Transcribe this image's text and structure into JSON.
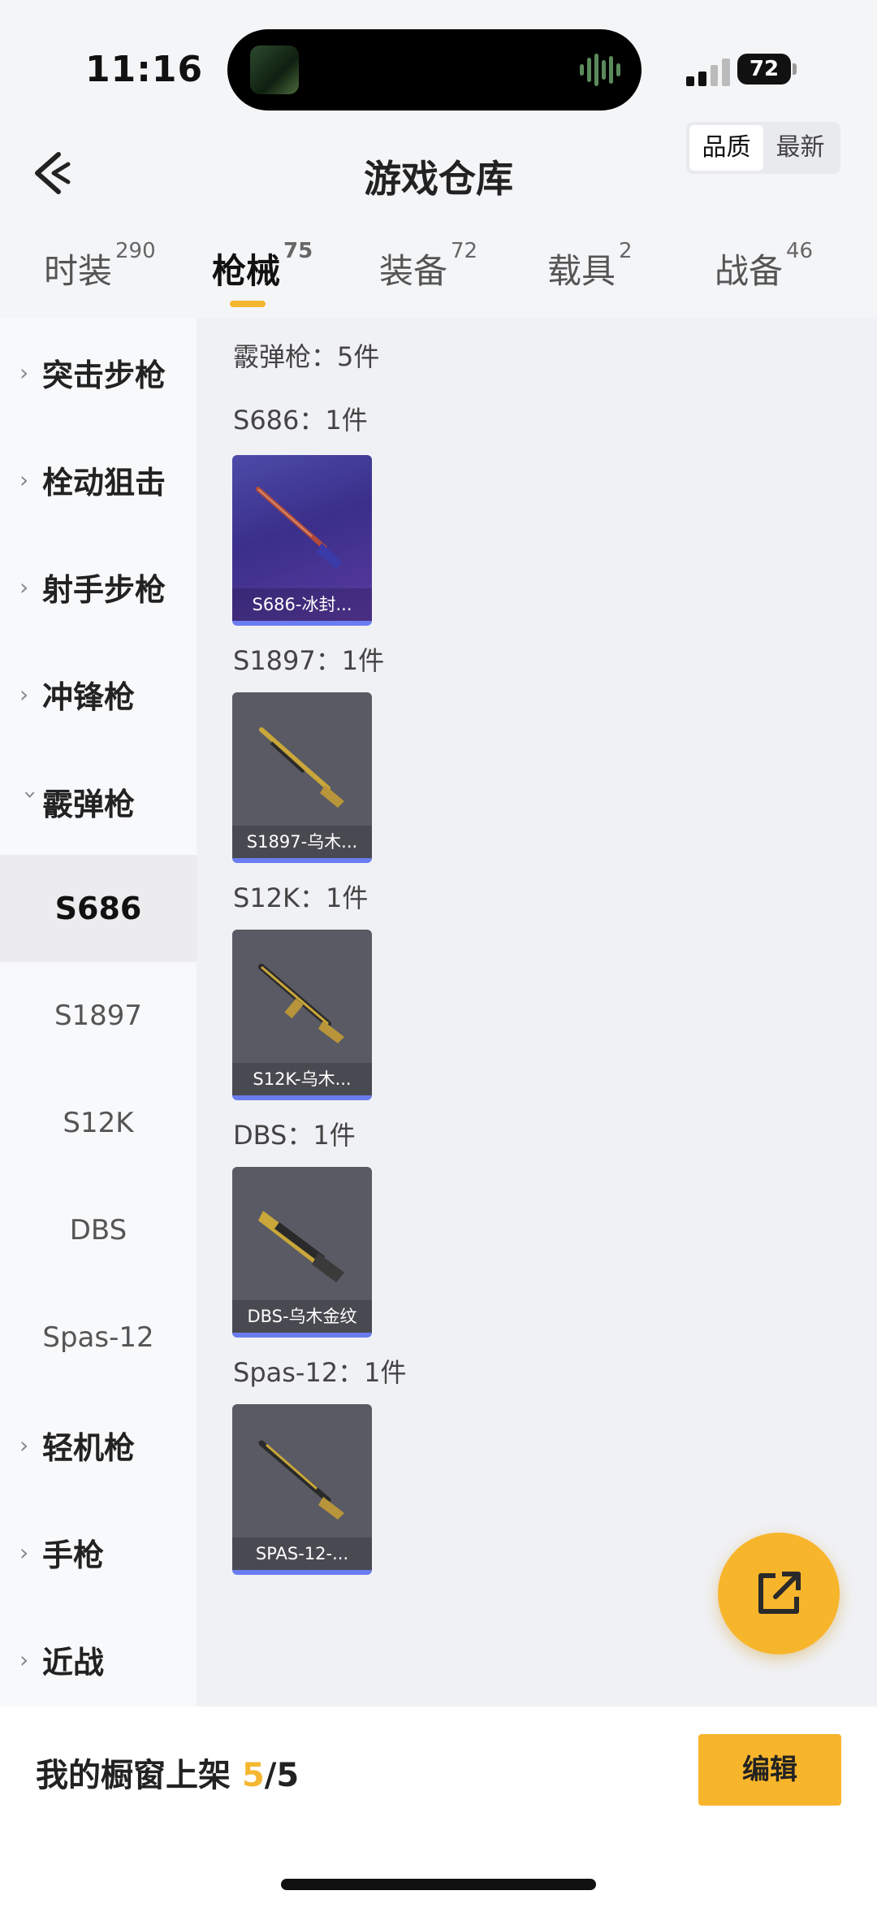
{
  "status_bar": {
    "time": "11:16",
    "battery": "72"
  },
  "header": {
    "title": "游戏仓库",
    "sort_options": [
      "品质",
      "最新"
    ],
    "sort_active": "品质"
  },
  "tabs": [
    {
      "label": "时装",
      "count": "290"
    },
    {
      "label": "枪械",
      "count": "75",
      "active": true
    },
    {
      "label": "装备",
      "count": "72"
    },
    {
      "label": "载具",
      "count": "2"
    },
    {
      "label": "战备",
      "count": "46"
    }
  ],
  "sidebar": {
    "categories": [
      {
        "label": "突击步枪"
      },
      {
        "label": "栓动狙击"
      },
      {
        "label": "射手步枪"
      },
      {
        "label": "冲锋枪"
      },
      {
        "label": "霰弹枪",
        "expanded": true
      }
    ],
    "subitems": [
      {
        "label": "S686",
        "active": true
      },
      {
        "label": "S1897"
      },
      {
        "label": "S12K"
      },
      {
        "label": "DBS"
      },
      {
        "label": "Spas-12"
      }
    ],
    "categories_after": [
      {
        "label": "轻机枪"
      },
      {
        "label": "手枪"
      },
      {
        "label": "近战"
      }
    ]
  },
  "content": {
    "summary": "霰弹枪：5件",
    "groups": [
      {
        "heading": "S686：1件",
        "item_label": "S686-冰封...",
        "rarity_color": "#6a5ad0"
      },
      {
        "heading": "S1897：1件",
        "item_label": "S1897-乌木...",
        "rarity_color": "#6a7cf0"
      },
      {
        "heading": "S12K：1件",
        "item_label": "S12K-乌木...",
        "rarity_color": "#6a7cf0"
      },
      {
        "heading": "DBS：1件",
        "item_label": "DBS-乌木金纹",
        "rarity_color": "#6a7cf0"
      },
      {
        "heading": "Spas-12：1件",
        "item_label": "SPAS-12-...",
        "rarity_color": "#6a7cf0"
      }
    ]
  },
  "bottom_bar": {
    "shelf_label": "我的橱窗上架",
    "shelf_count": "5",
    "shelf_total": "/5",
    "edit_label": "编辑"
  },
  "icons": {
    "back": "back-arrow-icon",
    "share": "share-external-icon",
    "chevron": "chevron-right-icon"
  },
  "colors": {
    "accent": "#f7b52c",
    "rarity_blue": "#6a7cf0"
  }
}
